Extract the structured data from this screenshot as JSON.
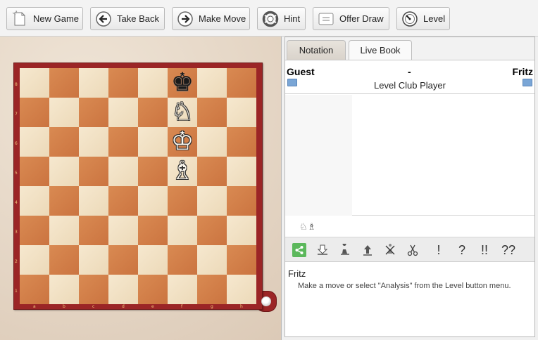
{
  "toolbar": {
    "new_game": "New Game",
    "take_back": "Take Back",
    "make_move": "Make Move",
    "hint": "Hint",
    "offer_draw": "Offer Draw",
    "level": "Level"
  },
  "tabs": {
    "notation": "Notation",
    "live_book": "Live Book"
  },
  "game_header": {
    "white": "Guest",
    "separator": "-",
    "black": "Fritz",
    "event": "Level Club Player"
  },
  "material": "♘♗",
  "edit_bar": {
    "exclam": "!",
    "question": "?",
    "double_exclam": "!!",
    "double_question": "??"
  },
  "engine": {
    "name": "Fritz",
    "message": "Make a move or select \"Analysis\" from the Level button menu."
  },
  "board": {
    "ranks": [
      "8",
      "7",
      "6",
      "5",
      "4",
      "3",
      "2",
      "1"
    ],
    "files": [
      "a",
      "b",
      "c",
      "d",
      "e",
      "f",
      "g",
      "h"
    ],
    "pieces": [
      {
        "square": "f8",
        "color": "black",
        "glyph": "♚"
      },
      {
        "square": "f7",
        "color": "white",
        "glyph": "♘"
      },
      {
        "square": "f6",
        "color": "white",
        "glyph": "♔"
      },
      {
        "square": "f5",
        "color": "white",
        "glyph": "♗"
      }
    ],
    "colors": {
      "light": "#f3e3c7",
      "dark": "#d3804a",
      "frame": "#9b2526"
    }
  },
  "icons": [
    "new-game-icon",
    "take-back-icon",
    "make-move-icon",
    "hint-icon",
    "offer-draw-icon",
    "level-icon",
    "share-icon",
    "save-icon",
    "insert-move-icon",
    "promote-icon",
    "delete-icon",
    "cut-icon"
  ]
}
